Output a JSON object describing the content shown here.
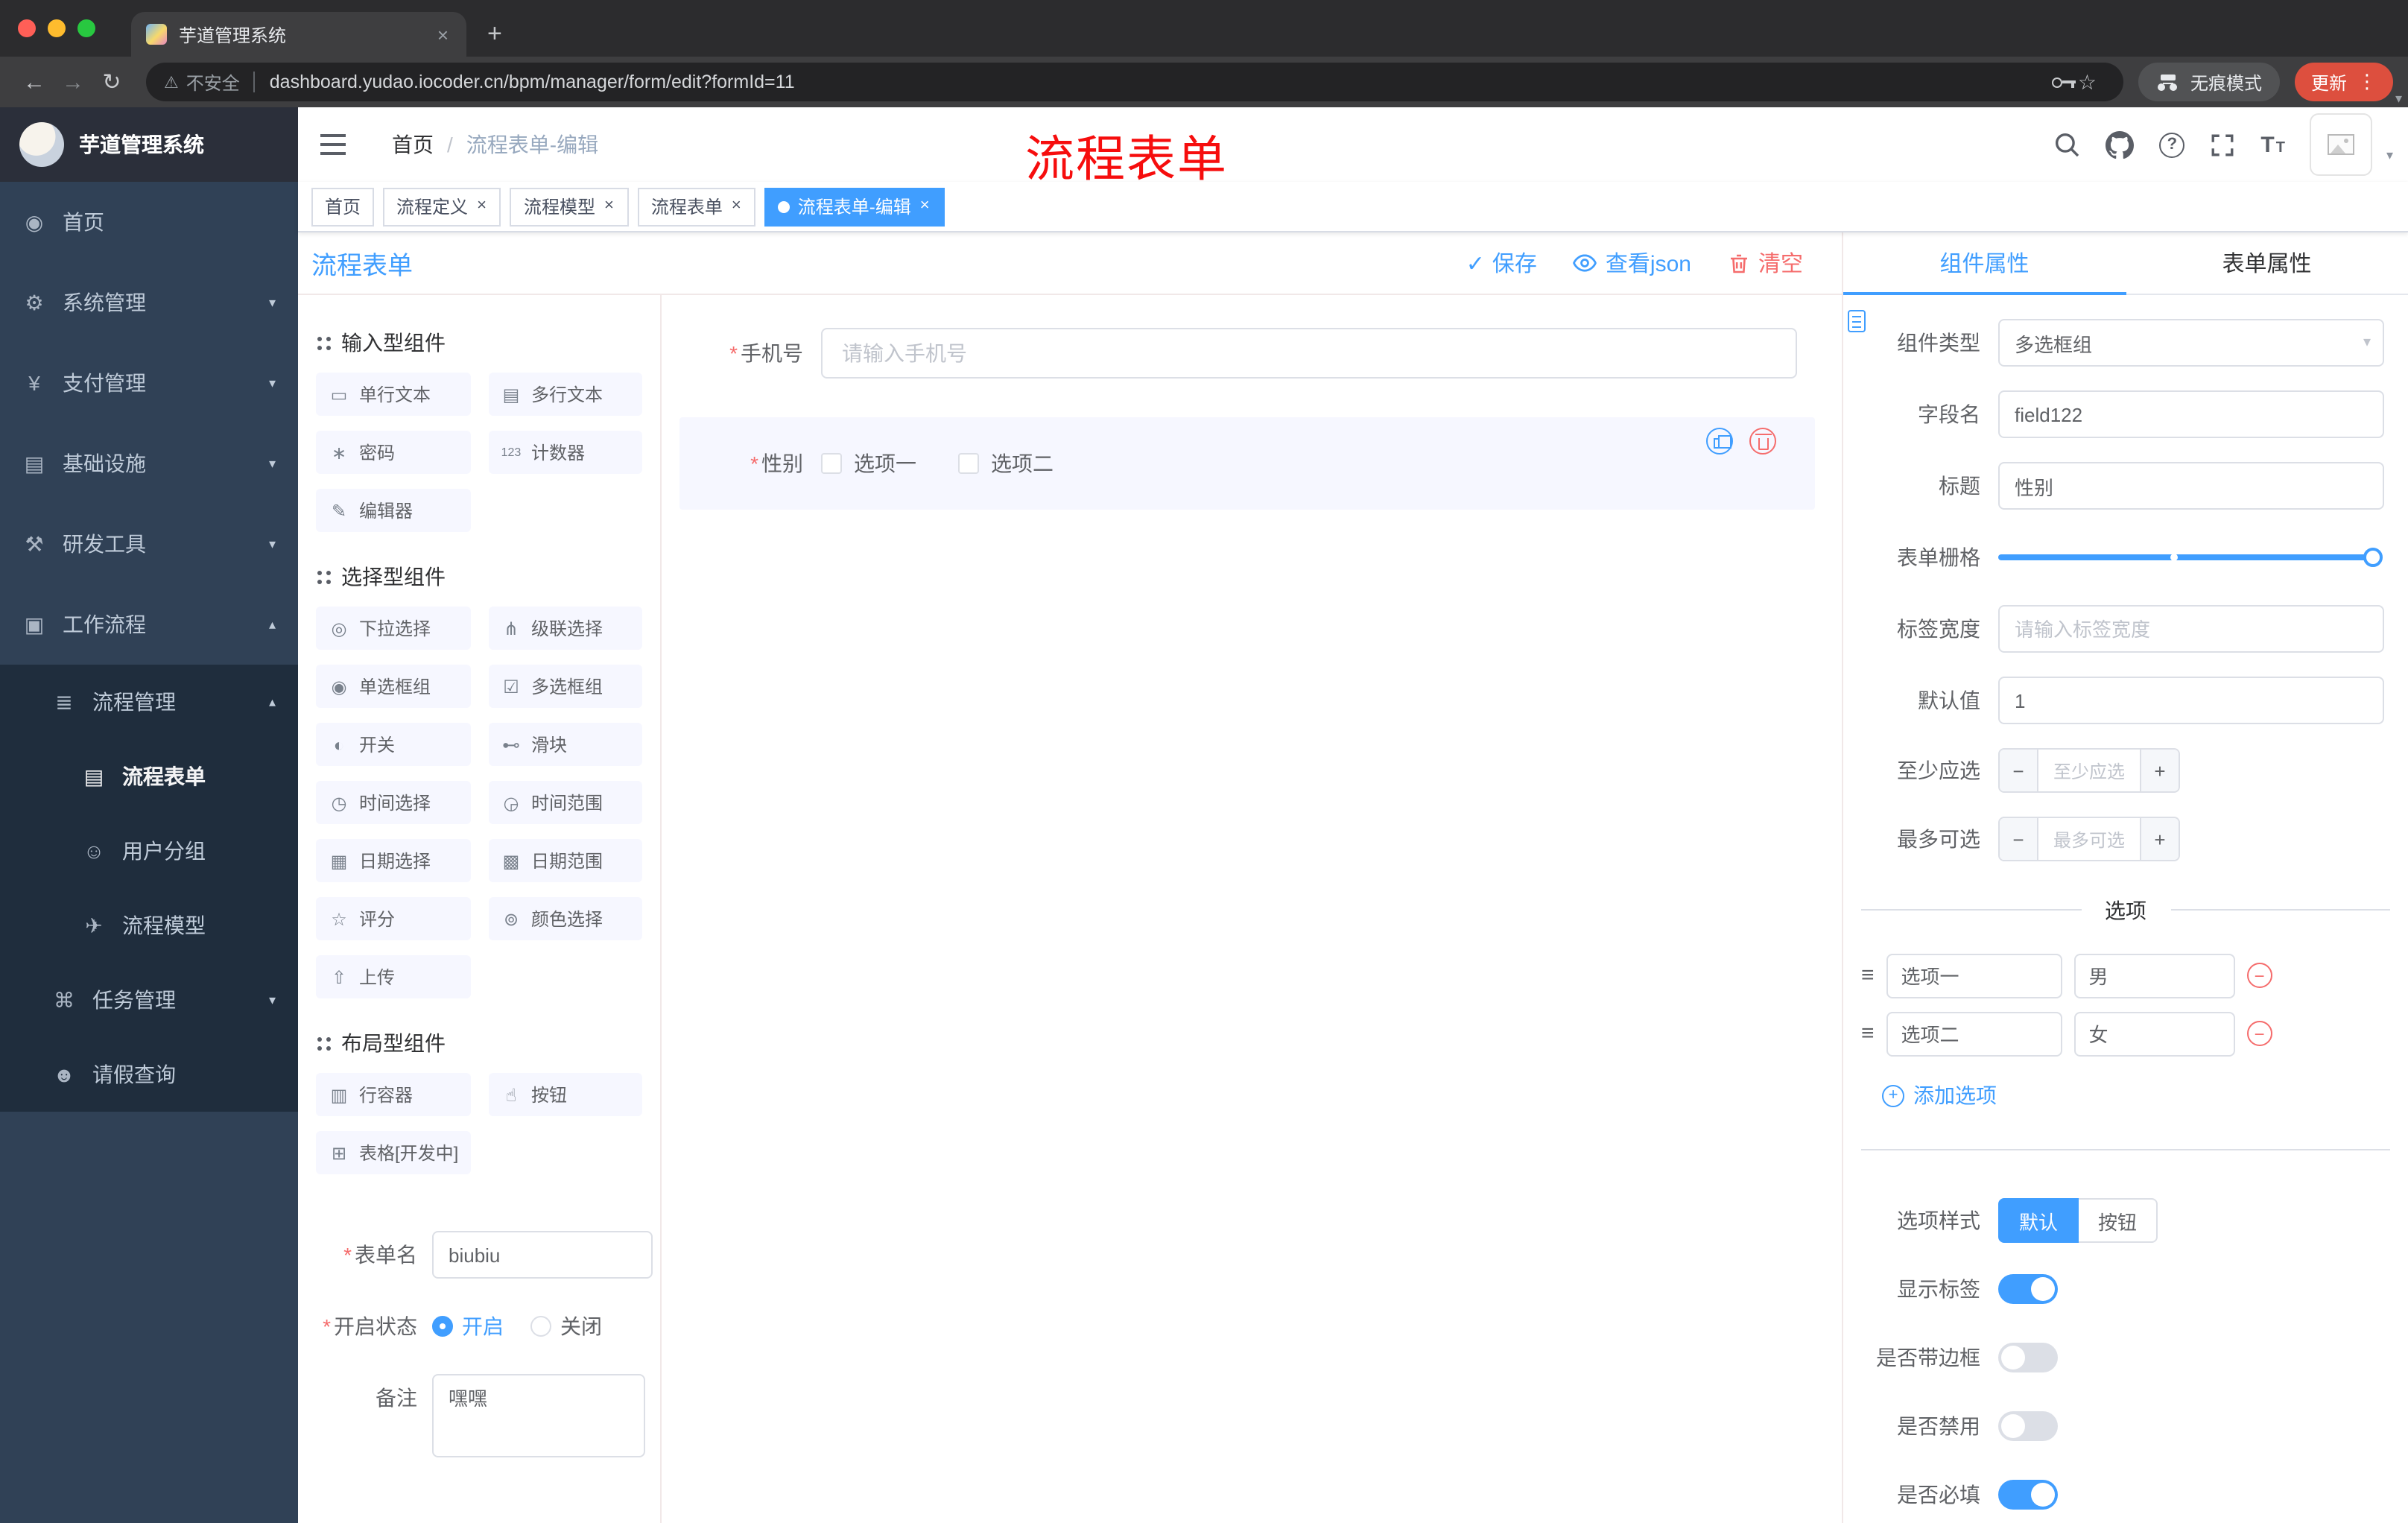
{
  "ui": {
    "req": "*",
    "close": "×",
    "plus": "+",
    "minus": "−",
    "check": "✓",
    "question": "?",
    "star": "☆",
    "back": "←",
    "forward": "→",
    "reload": "↻",
    "warn": "⚠",
    "dots": "⋮",
    "caret": "▾",
    "size_icon": "T",
    "equals": "≡"
  },
  "browser": {
    "tab": {
      "title": "芋道管理系统"
    },
    "address": {
      "security": "不安全",
      "url": "dashboard.yudao.iocoder.cn/bpm/manager/form/edit?formId=11"
    },
    "incognito_label": "无痕模式",
    "update_label": "更新"
  },
  "sidebar": {
    "logo": "芋道管理系统",
    "menu": [
      {
        "icon": "◉",
        "label": "首页",
        "chevron": ""
      },
      {
        "icon": "⚙",
        "label": "系统管理",
        "chevron": "▾"
      },
      {
        "icon": "¥",
        "label": "支付管理",
        "chevron": "▾"
      },
      {
        "icon": "▤",
        "label": "基础设施",
        "chevron": "▾"
      },
      {
        "icon": "⚒",
        "label": "研发工具",
        "chevron": "▾"
      },
      {
        "icon": "▣",
        "label": "工作流程",
        "chevron": "▴"
      }
    ],
    "submenu": {
      "group": {
        "icon": "≣",
        "label": "流程管理",
        "chevron": "▴"
      },
      "children": [
        {
          "icon": "▤",
          "label": "流程表单"
        },
        {
          "icon": "☺",
          "label": "用户分组"
        },
        {
          "icon": "✈",
          "label": "流程模型"
        }
      ],
      "task": {
        "icon": "⌘",
        "label": "任务管理",
        "chevron": "▾"
      },
      "leave": {
        "icon": "☻",
        "label": "请假查询"
      }
    }
  },
  "header": {
    "breadcrumb": {
      "root": "首页",
      "sep": "/",
      "current": "流程表单-编辑"
    },
    "annotation": "流程表单"
  },
  "tags": [
    {
      "label": "首页"
    },
    {
      "label": "流程定义"
    },
    {
      "label": "流程模型"
    },
    {
      "label": "流程表单"
    },
    {
      "label": "流程表单-编辑"
    }
  ],
  "designer": {
    "title": "流程表单",
    "save": "保存",
    "view_json": "查看json",
    "clear": "清空"
  },
  "palette": {
    "sections": [
      {
        "title": "输入型组件",
        "items": [
          {
            "icon": "▭",
            "label": "单行文本"
          },
          {
            "icon": "▤",
            "label": "多行文本"
          },
          {
            "icon": "∗",
            "label": "密码"
          },
          {
            "icon": "123",
            "label": "计数器"
          },
          {
            "icon": "✎",
            "label": "编辑器"
          }
        ]
      },
      {
        "title": "选择型组件",
        "items": [
          {
            "icon": "◎",
            "label": "下拉选择"
          },
          {
            "icon": "⋔",
            "label": "级联选择"
          },
          {
            "icon": "◉",
            "label": "单选框组"
          },
          {
            "icon": "☑",
            "label": "多选框组"
          },
          {
            "icon": "◐",
            "label": "开关"
          },
          {
            "icon": "⊷",
            "label": "滑块"
          },
          {
            "icon": "◷",
            "label": "时间选择"
          },
          {
            "icon": "◶",
            "label": "时间范围"
          },
          {
            "icon": "▦",
            "label": "日期选择"
          },
          {
            "icon": "▩",
            "label": "日期范围"
          },
          {
            "icon": "☆",
            "label": "评分"
          },
          {
            "icon": "⊚",
            "label": "颜色选择"
          },
          {
            "icon": "⇧",
            "label": "上传"
          }
        ]
      },
      {
        "title": "布局型组件",
        "items": [
          {
            "icon": "▥",
            "label": "行容器"
          },
          {
            "icon": "☝",
            "label": "按钮"
          },
          {
            "icon": "⊞",
            "label": "表格[开发中]"
          }
        ]
      }
    ],
    "meta": {
      "name_label": "表单名",
      "name_value": "biubiu",
      "status_label": "开启状态",
      "status_on": "开启",
      "status_off": "关闭",
      "remark_label": "备注",
      "remark_value": "嘿嘿"
    }
  },
  "canvas": {
    "phone": {
      "label": "手机号",
      "placeholder": "请输入手机号"
    },
    "gender": {
      "label": "性别",
      "options": [
        "选项一",
        "选项二"
      ]
    }
  },
  "props": {
    "tabs": {
      "component": "组件属性",
      "form": "表单属性"
    },
    "component_type": {
      "label": "组件类型",
      "value": "多选框组"
    },
    "field_name": {
      "label": "字段名",
      "value": "field122"
    },
    "title_row": {
      "label": "标题",
      "value": "性别"
    },
    "grid": {
      "label": "表单栅格"
    },
    "label_width": {
      "label": "标签宽度",
      "placeholder": "请输入标签宽度"
    },
    "default_value": {
      "label": "默认值",
      "value": "1"
    },
    "min_select": {
      "label": "至少应选",
      "placeholder": "至少应选"
    },
    "max_select": {
      "label": "最多可选",
      "placeholder": "最多可选"
    },
    "options_title": "选项",
    "options": [
      {
        "name": "选项一",
        "value": "男"
      },
      {
        "name": "选项二",
        "value": "女"
      }
    ],
    "add_option": "添加选项",
    "option_style": {
      "label": "选项样式",
      "default": "默认",
      "button": "按钮"
    },
    "toggles": [
      {
        "label": "显示标签",
        "on": true
      },
      {
        "label": "是否带边框",
        "on": false
      },
      {
        "label": "是否禁用",
        "on": false
      },
      {
        "label": "是否必填",
        "on": true
      }
    ]
  },
  "colors": {
    "primary": "#409eff",
    "danger": "#f56c6c",
    "annotation_red": "#f60d0d",
    "sidebar_bg": "#304156",
    "submenu_bg": "#1f2d3d"
  }
}
